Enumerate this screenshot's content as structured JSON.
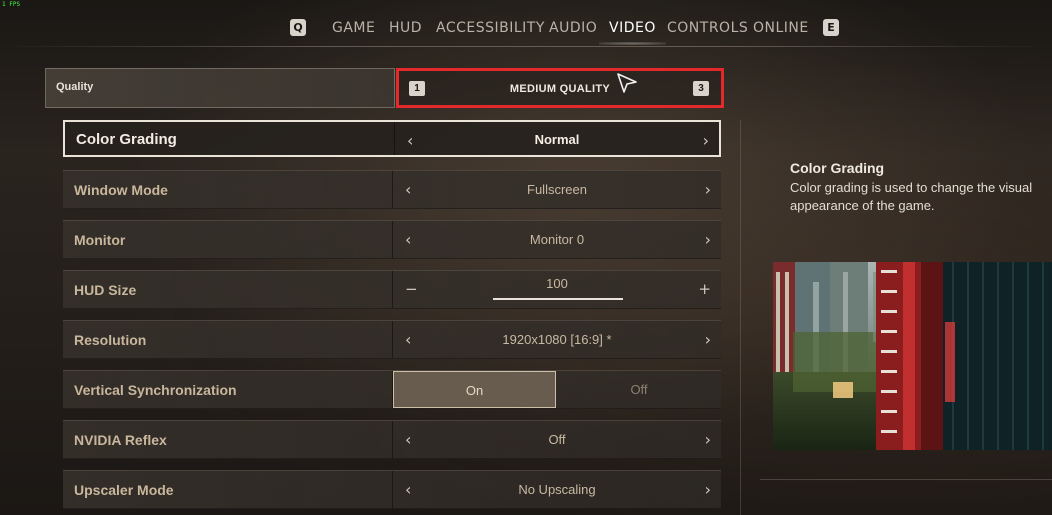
{
  "fps": "1 FPS",
  "nav": {
    "left_key": "Q",
    "right_key": "E",
    "tabs": [
      {
        "label": "GAME",
        "active": false
      },
      {
        "label": "HUD",
        "active": false
      },
      {
        "label": "ACCESSIBILITY",
        "active": false
      },
      {
        "label": "AUDIO",
        "active": false
      },
      {
        "label": "VIDEO",
        "active": true
      },
      {
        "label": "CONTROLS",
        "active": false
      },
      {
        "label": "ONLINE",
        "active": false
      }
    ]
  },
  "quality": {
    "label": "Quality",
    "value": "MEDIUM QUALITY",
    "prev_key": "1",
    "next_key": "3"
  },
  "settings": [
    {
      "label": "Color Grading",
      "value": "Normal",
      "type": "arrows",
      "selected": true
    },
    {
      "label": "Window Mode",
      "value": "Fullscreen",
      "type": "arrows"
    },
    {
      "label": "Monitor",
      "value": "Monitor 0",
      "type": "arrows"
    },
    {
      "label": "HUD Size",
      "value": "100",
      "type": "slider",
      "minus": "−",
      "plus": "+"
    },
    {
      "label": "Resolution",
      "value": "1920x1080 [16:9] *",
      "type": "arrows"
    },
    {
      "label": "Vertical Synchronization",
      "type": "toggle",
      "on_label": "On",
      "off_label": "Off",
      "value": "On"
    },
    {
      "label": "NVIDIA Reflex",
      "value": "Off",
      "type": "arrows"
    },
    {
      "label": "Upscaler Mode",
      "value": "No Upscaling",
      "type": "arrows"
    }
  ],
  "arrow_glyphs": {
    "left": "‹",
    "right": "›"
  },
  "info": {
    "title": "Color Grading",
    "description": "Color grading is used to change the visual appearance of the game."
  },
  "colors": {
    "highlight_box": "#e3292b",
    "accent_text": "#c9b79d"
  }
}
